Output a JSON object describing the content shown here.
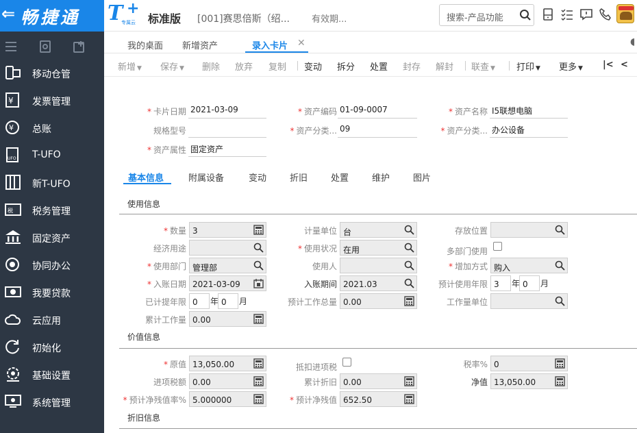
{
  "brand": {
    "name": "畅捷通",
    "logo_sub": "专属云",
    "edition": "标准版",
    "company": "[001]赛思倍斯（绍...",
    "validity": "有效期..."
  },
  "search": {
    "placeholder": "搜索-产品功能"
  },
  "top_icons": [
    "tablet-icon",
    "checklist-icon",
    "chat-icon",
    "phone-icon",
    "avatar-badge"
  ],
  "sidebar": {
    "items": [
      {
        "label": "移动仓管",
        "icon": "mobile-warehouse-icon"
      },
      {
        "label": "发票管理",
        "icon": "invoice-icon"
      },
      {
        "label": "总账",
        "icon": "ledger-icon"
      },
      {
        "label": "T-UFO",
        "icon": "tufo-icon"
      },
      {
        "label": "新T-UFO",
        "icon": "new-tufo-icon"
      },
      {
        "label": "税务管理",
        "icon": "tax-icon"
      },
      {
        "label": "固定资产",
        "icon": "bank-icon"
      },
      {
        "label": "协同办公",
        "icon": "collab-icon"
      },
      {
        "label": "我要贷款",
        "icon": "loan-icon"
      },
      {
        "label": "云应用",
        "icon": "cloud-icon"
      },
      {
        "label": "初始化",
        "icon": "init-icon"
      },
      {
        "label": "基础设置",
        "icon": "settings-icon"
      },
      {
        "label": "系统管理",
        "icon": "system-icon"
      }
    ]
  },
  "tabs": [
    {
      "label": "我的桌面"
    },
    {
      "label": "新增资产"
    },
    {
      "label": "录入卡片"
    }
  ],
  "toolbar": {
    "items": [
      {
        "label": "新增",
        "dropdown": true,
        "enabled": false
      },
      {
        "label": "保存",
        "dropdown": true,
        "enabled": false
      },
      {
        "label": "删除",
        "enabled": false
      },
      {
        "label": "放弃",
        "enabled": false
      },
      {
        "label": "复制",
        "enabled": false
      },
      {
        "label": "变动",
        "enabled": true
      },
      {
        "label": "拆分",
        "enabled": true
      },
      {
        "label": "处置",
        "enabled": true
      },
      {
        "label": "封存",
        "enabled": false
      },
      {
        "label": "解封",
        "enabled": false
      },
      {
        "label": "联查",
        "dropdown": true,
        "enabled": false
      },
      {
        "label": "打印",
        "dropdown": true,
        "enabled": true
      },
      {
        "label": "更多",
        "dropdown": true,
        "enabled": true
      }
    ]
  },
  "header_fields": {
    "card_date": {
      "label": "卡片日期",
      "value": "2021-03-09"
    },
    "asset_code": {
      "label": "资产编码",
      "value": "01-09-0007"
    },
    "asset_name": {
      "label": "资产名称",
      "value": "I5联想电脑"
    },
    "spec": {
      "label": "规格型号",
      "value": ""
    },
    "category_code": {
      "label": "资产分类...",
      "value": "09"
    },
    "category_name": {
      "label": "资产分类...",
      "value": "办公设备"
    },
    "attribute": {
      "label": "资产属性",
      "value": "固定资产"
    }
  },
  "sub_tabs": [
    {
      "label": "基本信息"
    },
    {
      "label": "附属设备"
    },
    {
      "label": "变动"
    },
    {
      "label": "折旧"
    },
    {
      "label": "处置"
    },
    {
      "label": "维护"
    },
    {
      "label": "图片"
    }
  ],
  "usage": {
    "title": "使用信息",
    "quantity": {
      "label": "数量",
      "value": "3"
    },
    "unit": {
      "label": "计量单位",
      "value": "台"
    },
    "location": {
      "label": "存放位置",
      "value": ""
    },
    "economic_use": {
      "label": "经济用途",
      "value": ""
    },
    "usage_status": {
      "label": "使用状况",
      "value": "在用"
    },
    "multi_dept": {
      "label": "多部门使用",
      "checked": false
    },
    "dept": {
      "label": "使用部门",
      "value": "管理部"
    },
    "user": {
      "label": "使用人",
      "value": ""
    },
    "add_method": {
      "label": "增加方式",
      "value": "购入"
    },
    "entry_date": {
      "label": "入账日期",
      "value": "2021-03-09"
    },
    "entry_period": {
      "label": "入账期间",
      "value": "2021.03"
    },
    "expected_life": {
      "label": "预计使用年限",
      "years": "3",
      "year_unit": "年",
      "months": "0",
      "month_unit": "月"
    },
    "accrued_life": {
      "label": "已计提年限",
      "years": "0",
      "year_unit": "年",
      "months": "0",
      "month_unit": "月"
    },
    "expected_workload": {
      "label": "预计工作总量",
      "value": "0.00"
    },
    "workload_unit": {
      "label": "工作量单位",
      "value": ""
    },
    "accum_workload": {
      "label": "累计工作量",
      "value": "0.00"
    }
  },
  "value": {
    "title": "价值信息",
    "original": {
      "label": "原值",
      "value": "13,050.00"
    },
    "deduct_tax": {
      "label": "抵扣进项税",
      "checked": false
    },
    "tax_rate": {
      "label": "税率%",
      "value": "0"
    },
    "input_tax": {
      "label": "进项税额",
      "value": "0.00"
    },
    "accum_depr": {
      "label": "累计折旧",
      "value": "0.00"
    },
    "net_value": {
      "label": "净值",
      "value": "13,050.00"
    },
    "residual_rate": {
      "label": "预计净残值率%",
      "value": "5.000000"
    },
    "residual_value": {
      "label": "预计净残值",
      "value": "652.50"
    }
  },
  "depreciation": {
    "title": "折旧信息"
  },
  "colors": {
    "brand": "#1a86e8",
    "sidebar": "#2d3744",
    "required": "#e33333"
  }
}
